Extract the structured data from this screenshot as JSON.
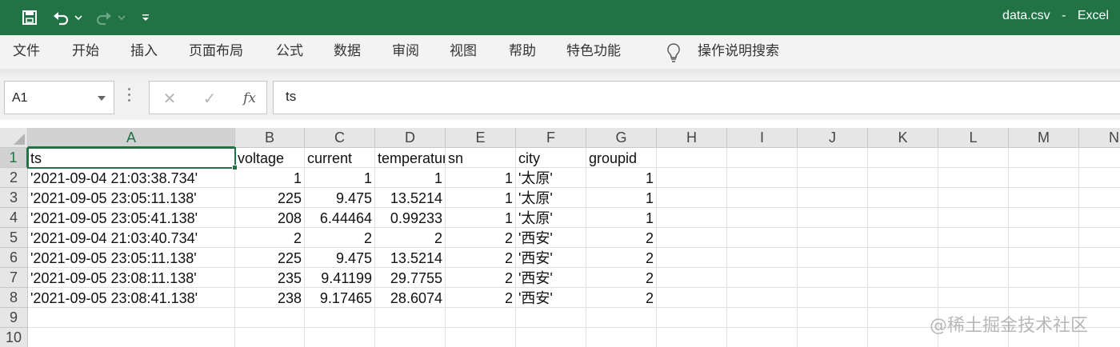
{
  "titlebar": {
    "filename": "data.csv",
    "separator": "-",
    "app": "Excel"
  },
  "ribbon": {
    "tabs": [
      "文件",
      "开始",
      "插入",
      "页面布局",
      "公式",
      "数据",
      "审阅",
      "视图",
      "帮助",
      "特色功能"
    ],
    "tell_me": "操作说明搜索"
  },
  "formula_bar": {
    "name_box": "A1",
    "fx_label": "fx",
    "content": "ts"
  },
  "columns": [
    "A",
    "B",
    "C",
    "D",
    "E",
    "F",
    "G",
    "H",
    "I",
    "J",
    "K",
    "L",
    "M",
    "N"
  ],
  "rows": [
    "1",
    "2",
    "3",
    "4",
    "5",
    "6",
    "7",
    "8",
    "9",
    "10"
  ],
  "sheet": {
    "header": [
      "ts",
      "voltage",
      "current",
      "temperature",
      "sn",
      "city",
      "groupid"
    ],
    "data": [
      [
        "'2021-09-04 21:03:38.734'",
        "1",
        "1",
        "1",
        "1",
        "'太原'",
        "1"
      ],
      [
        "'2021-09-05 23:05:11.138'",
        "225",
        "9.475",
        "13.5214",
        "1",
        "'太原'",
        "1"
      ],
      [
        "'2021-09-05 23:05:41.138'",
        "208",
        "6.44464",
        "0.99233",
        "1",
        "'太原'",
        "1"
      ],
      [
        "'2021-09-04 21:03:40.734'",
        "2",
        "2",
        "2",
        "2",
        "'西安'",
        "2"
      ],
      [
        "'2021-09-05 23:05:11.138'",
        "225",
        "9.475",
        "13.5214",
        "2",
        "'西安'",
        "2"
      ],
      [
        "'2021-09-05 23:08:11.138'",
        "235",
        "9.41199",
        "29.7755",
        "2",
        "'西安'",
        "2"
      ],
      [
        "'2021-09-05 23:08:41.138'",
        "238",
        "9.17465",
        "28.6074",
        "2",
        "'西安'",
        "2"
      ]
    ]
  },
  "watermark": "@稀土掘金技术社区",
  "colors": {
    "accent": "#217346",
    "ribbon_bg": "#f3f3f3",
    "header_bg": "#e6e6e6"
  }
}
